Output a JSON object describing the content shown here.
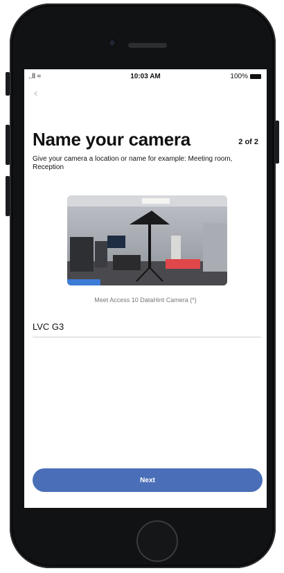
{
  "status_bar": {
    "signal": "..ll ≈",
    "time": "10:03 AM",
    "battery": "100%"
  },
  "nav": {
    "back_icon": "chevron-left-icon",
    "back_glyph": "‹"
  },
  "header": {
    "title": "Name your camera",
    "step": "2 of 2",
    "description": "Give your camera a location or name for example: Meeting room, Reception"
  },
  "preview": {
    "model_label": "Meet Access 10 DataHint Camera (*)"
  },
  "form": {
    "camera_name": "LVC G3"
  },
  "actions": {
    "next_label": "Next"
  },
  "colors": {
    "primary": "#4a6fb8",
    "phone_body": "#111214"
  }
}
